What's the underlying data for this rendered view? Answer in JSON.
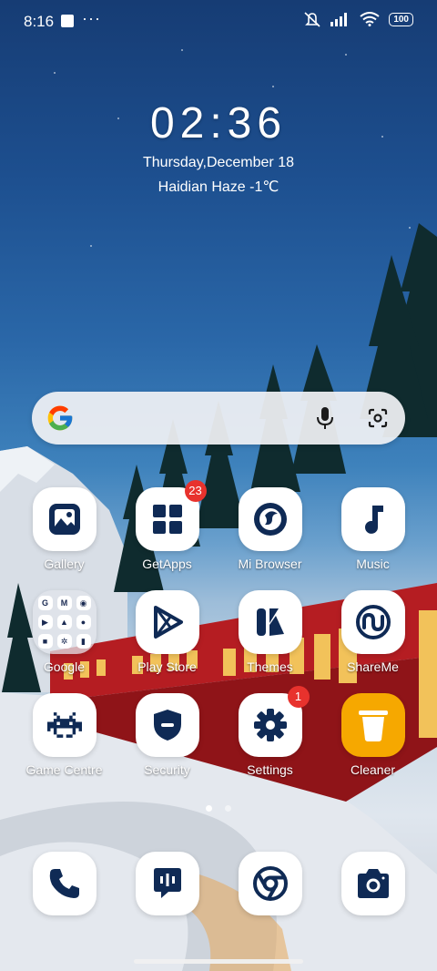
{
  "status_bar": {
    "time": "8:16",
    "overflow": "···",
    "battery": "100"
  },
  "clock": {
    "time": "02:36",
    "date": "Thursday,December 18",
    "weather": "Haidian Haze -1℃"
  },
  "search": {
    "mic_icon": "mic-icon",
    "lens_icon": "lens-icon"
  },
  "apps": [
    {
      "label": "Gallery",
      "icon": "gallery-icon"
    },
    {
      "label": "GetApps",
      "icon": "grid-icon",
      "badge": "23"
    },
    {
      "label": "Mi Browser",
      "icon": "browser-icon"
    },
    {
      "label": "Music",
      "icon": "music-note-icon"
    },
    {
      "label": "Google",
      "icon": "folder-icon"
    },
    {
      "label": "Play Store",
      "icon": "play-icon"
    },
    {
      "label": "Themes",
      "icon": "themes-icon"
    },
    {
      "label": "ShareMe",
      "icon": "shareme-icon"
    },
    {
      "label": "Game Centre",
      "icon": "invader-icon"
    },
    {
      "label": "Security",
      "icon": "shield-icon"
    },
    {
      "label": "Settings",
      "icon": "gear-icon",
      "badge": "1"
    },
    {
      "label": "Cleaner",
      "icon": "trash-icon"
    }
  ],
  "dock": [
    "phone-icon",
    "messages-icon",
    "chrome-icon",
    "camera-icon"
  ],
  "page_indicator": {
    "pages": 2,
    "current": 1
  },
  "colors": {
    "icon_fg": "#0f2a55",
    "badge": "#e8322d",
    "cleaner_bg": "#f6a800"
  }
}
